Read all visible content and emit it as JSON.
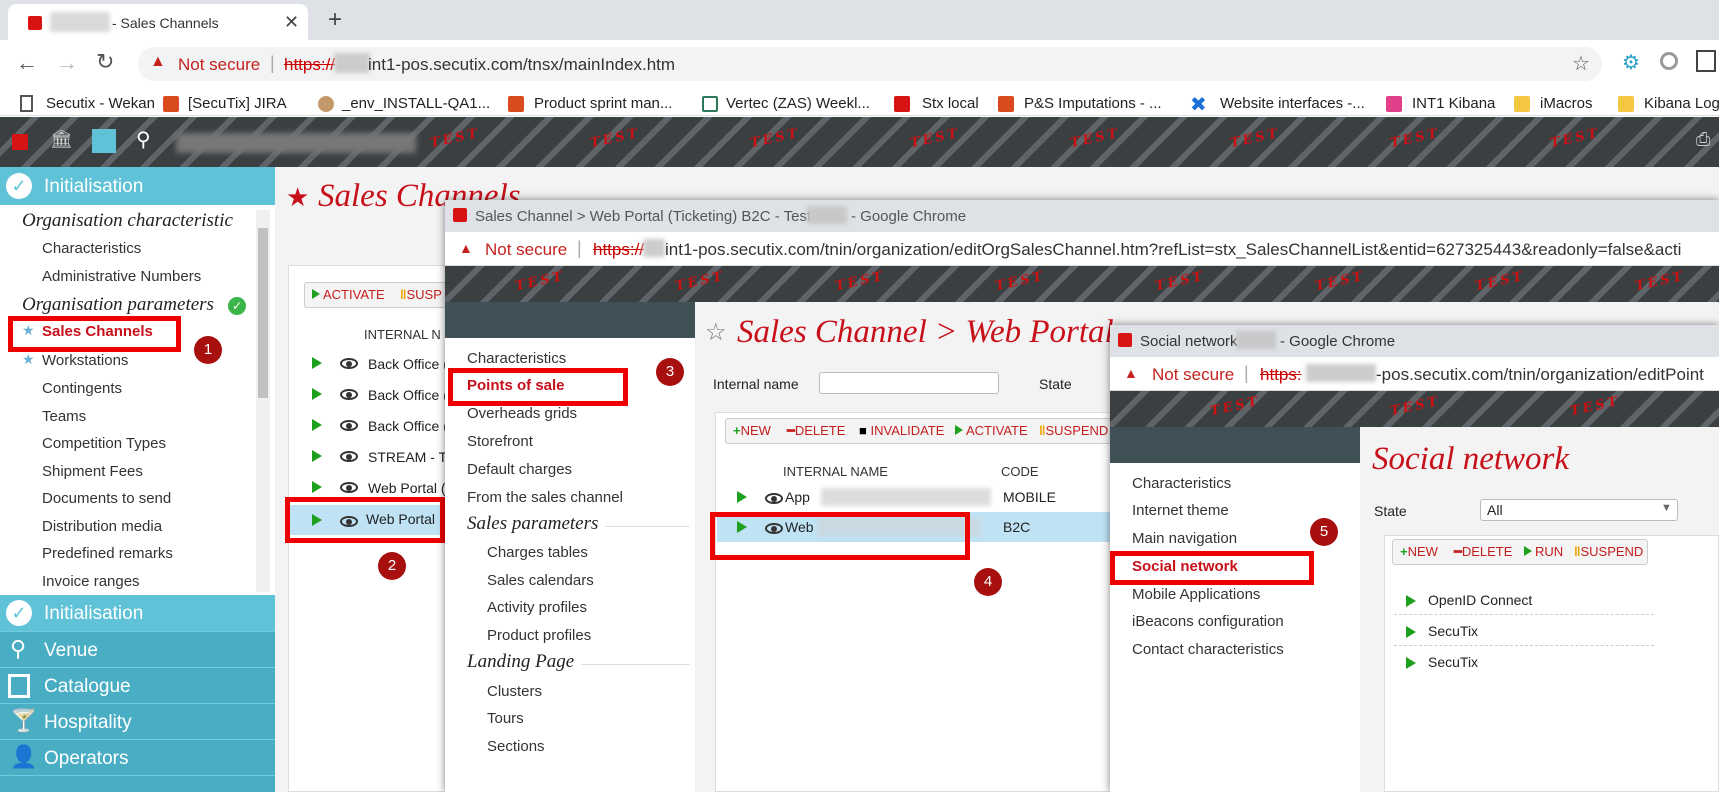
{
  "browser": {
    "tab_title": "- Sales Channels",
    "security": "Not secure",
    "url_scheme": "https://",
    "url_rest": "int1-pos.secutix.com/tnsx/mainIndex.htm",
    "bookmarks": [
      "Secutix - Wekan",
      "[SecuTix] JIRA",
      "_env_INSTALL-QA1...",
      "Product sprint man...",
      "Vertec (ZAS) Weekl...",
      "Stx local",
      "P&S Imputations - ...",
      "Website interfaces -...",
      "INT1 Kibana",
      "iMacros",
      "Kibana Log"
    ]
  },
  "banner_text": "TEST",
  "left_menu": {
    "top_section": "Initialisation",
    "group1": "Organisation characteristic",
    "group1_items": [
      "Characteristics",
      "Administrative Numbers"
    ],
    "group2": "Organisation parameters",
    "group2_items": [
      "Sales Channels",
      "Workstations",
      "Contingents",
      "Teams",
      "Competition Types",
      "Shipment Fees",
      "Documents to send",
      "Distribution media",
      "Predefined remarks",
      "Invoice ranges"
    ],
    "bottom_sections": [
      "Initialisation",
      "Venue",
      "Catalogue",
      "Hospitality",
      "Operators"
    ]
  },
  "main": {
    "title": "Sales Channels",
    "buttons": [
      "ACTIVATE",
      "SUSP"
    ],
    "col_internal": "INTERNAL N",
    "rows": [
      "Back Office (",
      "Back Office (",
      "Back Office (",
      "STREAM - T",
      "Web Portal (",
      "Web Portal"
    ]
  },
  "win2": {
    "chrome_title": "Sales Channel > Web Portal (Ticketing) B2C - Test",
    "chrome_suffix": "- Google Chrome",
    "security": "Not secure",
    "url_scheme": "https://",
    "url_rest": "int1-pos.secutix.com/tnin/organization/editOrgSalesChannel.htm?refList=stx_SalesChannelList&entid=627325443&readonly=false&acti",
    "title": "Sales Channel > Web Portal",
    "menu": [
      "Characteristics",
      "Points of sale",
      "Overheads grids",
      "Storefront",
      "Default charges",
      "From the sales channel"
    ],
    "menu_group2": "Sales parameters",
    "menu2": [
      "Charges tables",
      "Sales calendars",
      "Activity profiles",
      "Product profiles"
    ],
    "menu_group3": "Landing Page",
    "menu3": [
      "Clusters",
      "Tours",
      "Sections"
    ],
    "filter_label": "Internal name",
    "state_label": "State",
    "buttons": [
      "NEW",
      "DELETE",
      "INVALIDATE",
      "ACTIVATE",
      "SUSPEND"
    ],
    "col_internal": "INTERNAL NAME",
    "col_code": "CODE",
    "rows": [
      {
        "name": "App",
        "code": "MOBILE"
      },
      {
        "name": "Web",
        "code": "B2C"
      }
    ]
  },
  "win3": {
    "chrome_title": "Social network",
    "chrome_suffix": "- Google Chrome",
    "security": "Not secure",
    "url_scheme": "https:",
    "url_rest": "-pos.secutix.com/tnin/organization/editPoint",
    "title": "Social network",
    "menu": [
      "Characteristics",
      "Internet theme",
      "Main navigation",
      "Social network",
      "Mobile Applications",
      "iBeacons configuration",
      "Contact characteristics"
    ],
    "state_label": "State",
    "state_value": "All",
    "buttons": [
      "NEW",
      "DELETE",
      "RUN",
      "SUSPEND"
    ],
    "rows": [
      "OpenID Connect",
      "SecuTix",
      "SecuTix"
    ]
  },
  "badges": [
    "1",
    "2",
    "3",
    "4",
    "5"
  ]
}
